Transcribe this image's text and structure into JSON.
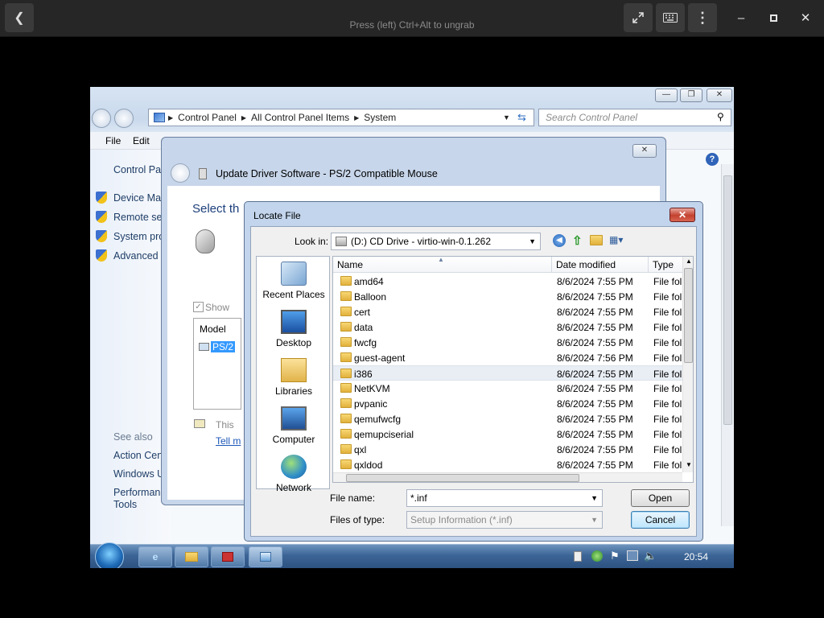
{
  "host": {
    "hint": "Press (left) Ctrl+Alt to ungrab",
    "icons": [
      "chevron-left-icon",
      "fullscreen-icon",
      "keyboard-icon",
      "more-vertical-icon",
      "minimize-icon",
      "maximize-icon",
      "close-icon"
    ]
  },
  "control_panel": {
    "address": [
      "Control Panel",
      "All Control Panel Items",
      "System"
    ],
    "search_placeholder": "Search Control Panel",
    "menu": {
      "file": "File",
      "edit": "Edit"
    },
    "left_pane": {
      "home": "Control Panel",
      "links": [
        "Device Manager",
        "Remote settings",
        "System protection",
        "Advanced system settings"
      ],
      "see_also_heading": "See also",
      "see_also": [
        "Action Center",
        "Windows Update",
        "Performance Information and Tools"
      ],
      "see_also_display": [
        "Action Cen",
        "Windows U",
        "Performance",
        "Tools"
      ],
      "links_display": [
        "Device Mar",
        "Remote set",
        "System pro",
        "Advanced s"
      ],
      "home_display": "Control Par"
    }
  },
  "update_driver": {
    "title": "Update Driver Software - PS/2 Compatible Mouse",
    "heading": "Select th",
    "show_label": "Show",
    "model_header": "Model",
    "model_item": "PS/2",
    "signed_text": "This",
    "tell_me": "Tell m"
  },
  "locate_file": {
    "title": "Locate File",
    "look_in_label": "Look in:",
    "look_in_value": "(D:) CD Drive - virtio-win-0.1.262",
    "places": [
      "Recent Places",
      "Desktop",
      "Libraries",
      "Computer",
      "Network"
    ],
    "columns": {
      "name": "Name",
      "date": "Date modified",
      "type": "Type"
    },
    "files": [
      {
        "name": "amd64",
        "date": "8/6/2024 7:55 PM",
        "type": "File fol"
      },
      {
        "name": "Balloon",
        "date": "8/6/2024 7:55 PM",
        "type": "File fol"
      },
      {
        "name": "cert",
        "date": "8/6/2024 7:55 PM",
        "type": "File fol"
      },
      {
        "name": "data",
        "date": "8/6/2024 7:55 PM",
        "type": "File fol"
      },
      {
        "name": "fwcfg",
        "date": "8/6/2024 7:55 PM",
        "type": "File fol"
      },
      {
        "name": "guest-agent",
        "date": "8/6/2024 7:56 PM",
        "type": "File fol"
      },
      {
        "name": "i386",
        "date": "8/6/2024 7:55 PM",
        "type": "File fol"
      },
      {
        "name": "NetKVM",
        "date": "8/6/2024 7:55 PM",
        "type": "File fol"
      },
      {
        "name": "pvpanic",
        "date": "8/6/2024 7:55 PM",
        "type": "File fol"
      },
      {
        "name": "qemufwcfg",
        "date": "8/6/2024 7:55 PM",
        "type": "File fol"
      },
      {
        "name": "qemupciserial",
        "date": "8/6/2024 7:55 PM",
        "type": "File fol"
      },
      {
        "name": "qxl",
        "date": "8/6/2024 7:55 PM",
        "type": "File fol"
      },
      {
        "name": "qxldod",
        "date": "8/6/2024 7:55 PM",
        "type": "File fol"
      }
    ],
    "selected_index": 6,
    "file_name_label": "File name:",
    "file_name_value": "*.inf",
    "files_of_type_label": "Files of type:",
    "files_of_type_value": "Setup Information (*.inf)",
    "open": "Open",
    "cancel": "Cancel"
  },
  "taskbar": {
    "clock": "20:54"
  },
  "colors": {
    "accent": "#3c6596",
    "selection": "#3399ff",
    "close_red": "#c3412f"
  }
}
